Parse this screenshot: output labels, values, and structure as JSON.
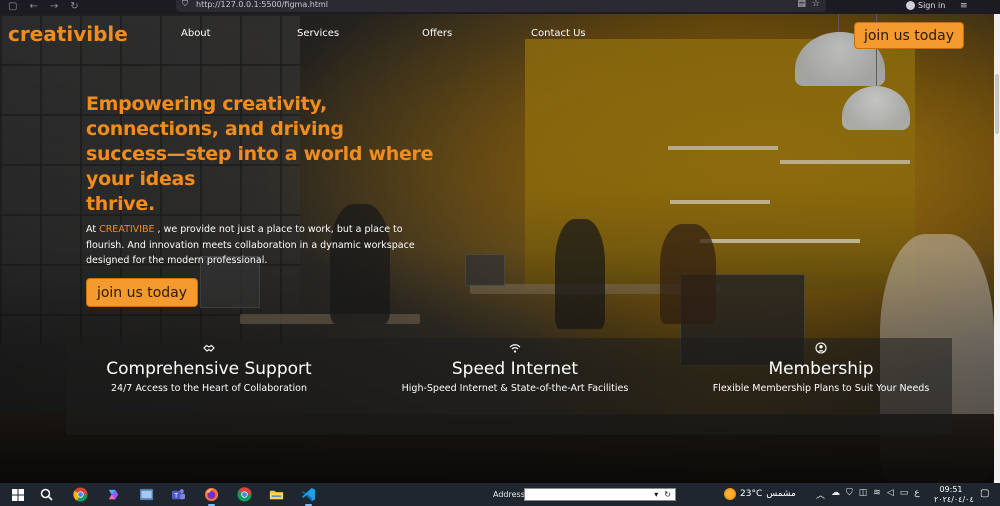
{
  "browser": {
    "url": "http://127.0.0.1:5500/figma.html",
    "signin_label": "Sign in"
  },
  "header": {
    "logo": "creativible",
    "nav": [
      "About",
      "Services",
      "Offers",
      "Contact Us"
    ],
    "cta": "join us today"
  },
  "hero": {
    "title_lines": [
      "Empowering creativity,",
      "connections, and driving",
      "success—step into a world where",
      "your ideas",
      "thrive."
    ],
    "desc_prefix": "At ",
    "desc_brand": "CREATIVIBE",
    "desc_rest": " , we provide not just a place to work, but a place to flourish. And innovation meets collaboration in a dynamic workspace designed for the modern professional.",
    "cta": "join us today"
  },
  "features": [
    {
      "icon": "handshake-icon",
      "title": "Comprehensive Support",
      "subtitle": "24/7 Access to the Heart of Collaboration"
    },
    {
      "icon": "wifi-icon",
      "title": "Speed Internet",
      "subtitle": "High-Speed Internet & State-of-the-Art Facilities"
    },
    {
      "icon": "user-circle-icon",
      "title": "Membership",
      "subtitle": "Flexible Membership Plans to Suit Your Needs"
    }
  ],
  "colors": {
    "accent": "#f28c1c",
    "button_bg": "#f59a2e",
    "taskbar": "#1f2630"
  },
  "taskbar": {
    "address_label": "Address",
    "address_value": "",
    "temperature": "23°C",
    "weather_text": "مشمس",
    "lang": "ع",
    "time": "09:51",
    "date": "٢٠٢٤/٠٤/٠٤"
  }
}
